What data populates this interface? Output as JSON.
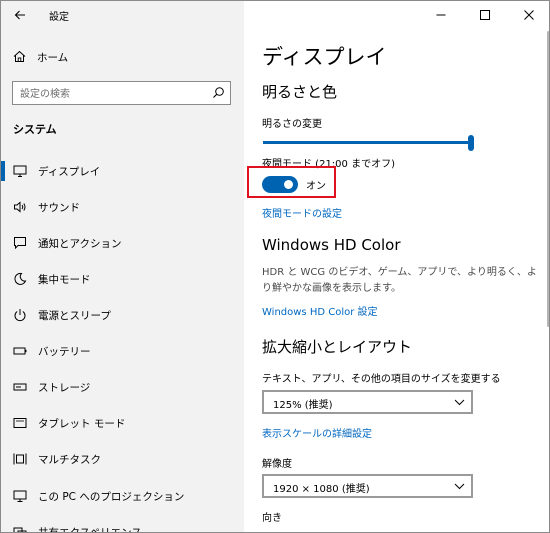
{
  "window": {
    "title": "設定"
  },
  "sidebar": {
    "home_label": "ホーム",
    "search_placeholder": "設定の検索",
    "section_label": "システム",
    "items": [
      {
        "label": "ディスプレイ",
        "icon": "monitor-icon",
        "selected": true
      },
      {
        "label": "サウンド",
        "icon": "speaker-icon",
        "selected": false
      },
      {
        "label": "通知とアクション",
        "icon": "notification-icon",
        "selected": false
      },
      {
        "label": "集中モード",
        "icon": "moon-icon",
        "selected": false
      },
      {
        "label": "電源とスリープ",
        "icon": "power-icon",
        "selected": false
      },
      {
        "label": "バッテリー",
        "icon": "battery-icon",
        "selected": false
      },
      {
        "label": "ストレージ",
        "icon": "storage-icon",
        "selected": false
      },
      {
        "label": "タブレット モード",
        "icon": "tablet-icon",
        "selected": false
      },
      {
        "label": "マルチタスク",
        "icon": "multitask-icon",
        "selected": false
      },
      {
        "label": "この PC へのプロジェクション",
        "icon": "projection-icon",
        "selected": false
      },
      {
        "label": "共有エクスペリエンス",
        "icon": "share-icon",
        "selected": false
      }
    ]
  },
  "main": {
    "page_title": "ディスプレイ",
    "brightness": {
      "heading": "明るさと色",
      "slider_label": "明るさの変更",
      "slider_value_percent": 100,
      "night_light_label": "夜間モード (21:00 までオフ)",
      "toggle_state": "オン",
      "night_light_settings_link": "夜間モードの設定"
    },
    "hdr": {
      "heading": "Windows HD Color",
      "description": "HDR と WCG のビデオ、ゲーム、アプリで、より明るく、より鮮やかな画像を表示します。",
      "settings_link": "Windows HD Color 設定"
    },
    "scale": {
      "heading": "拡大縮小とレイアウト",
      "text_size_label": "テキスト、アプリ、その他の項目のサイズを変更する",
      "scale_value": "125% (推奨)",
      "advanced_link": "表示スケールの詳細設定",
      "resolution_label": "解像度",
      "resolution_value": "1920 × 1080 (推奨)",
      "orientation_label": "向き"
    }
  },
  "colors": {
    "accent": "#0063b1",
    "link": "#0067c0",
    "highlight": "#e0111f",
    "sidebar_bg": "#f2f2f2"
  }
}
